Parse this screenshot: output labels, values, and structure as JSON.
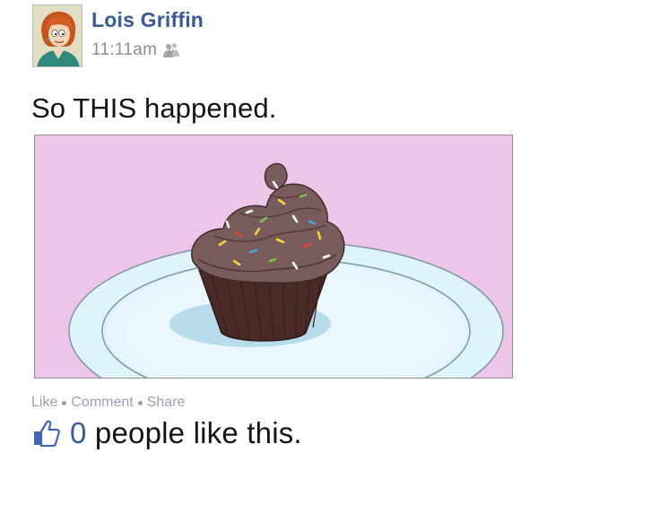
{
  "post": {
    "author_name": "Lois Griffin",
    "timestamp": "11:11am",
    "audience_icon": "friends-icon",
    "message": "So THIS happened.",
    "photo": {
      "description_icon": "cupcake-on-plate",
      "background_color": "#ecc5e8"
    },
    "actions": {
      "like": "Like",
      "comment": "Comment",
      "share": "Share"
    },
    "likes": {
      "icon": "thumbs-up-icon",
      "count": "0",
      "summary_rest": " people like this."
    }
  },
  "colors": {
    "link": "#3b5998",
    "muted": "#8e8e8e",
    "action_text": "#9ba0ae",
    "text": "#141414"
  }
}
